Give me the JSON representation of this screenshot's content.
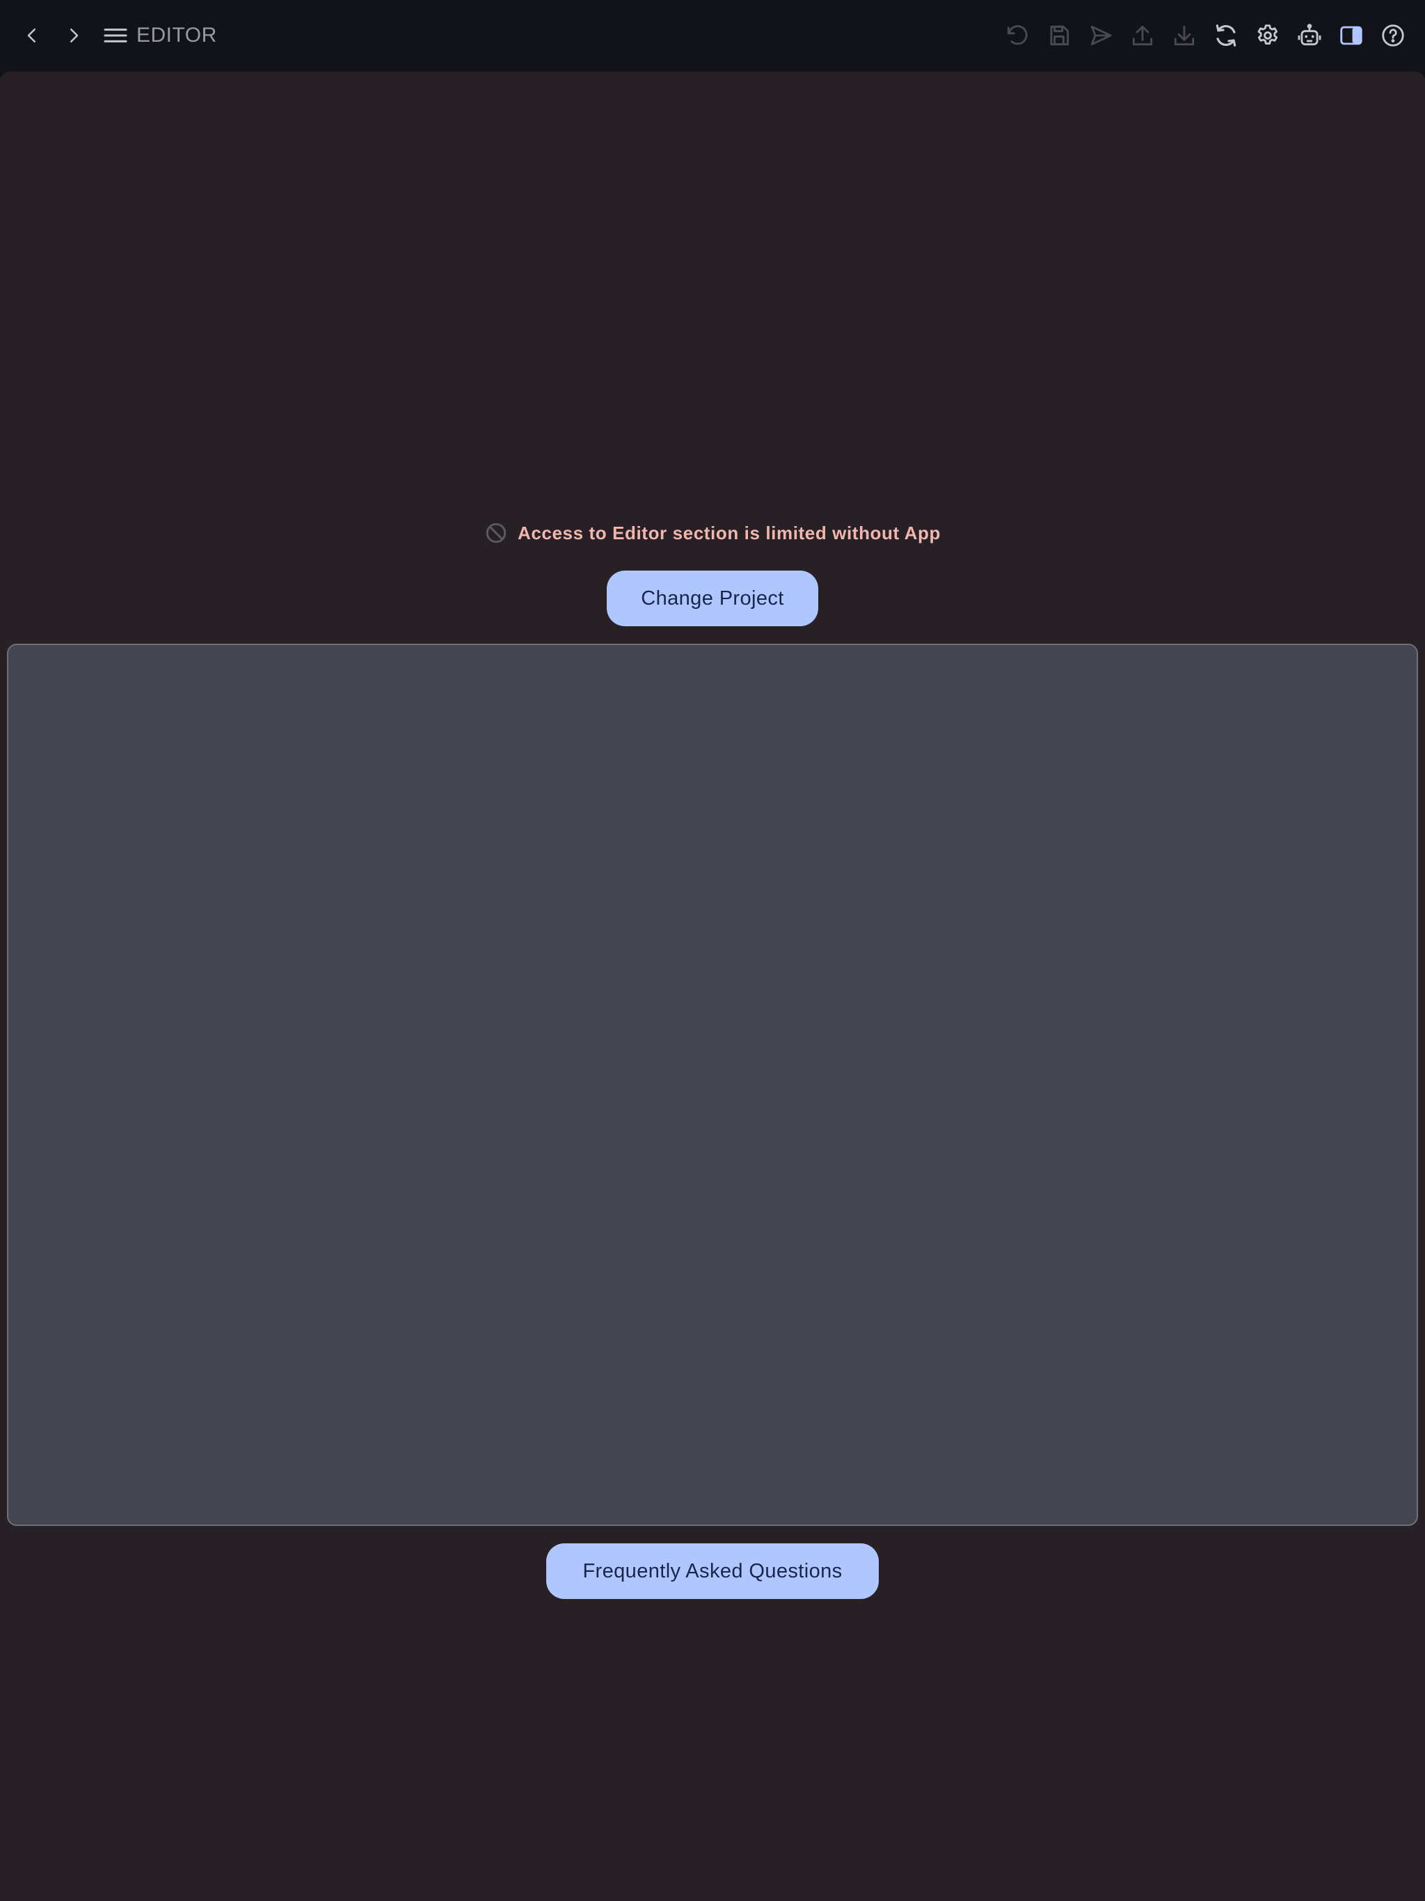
{
  "header": {
    "title": "EDITOR",
    "nav": {
      "back_icon": "chevron-left-icon",
      "forward_icon": "chevron-right-icon",
      "menu_icon": "menu-icon"
    },
    "toolbar": [
      {
        "icon": "undo-icon",
        "enabled": false
      },
      {
        "icon": "save-icon",
        "enabled": false
      },
      {
        "icon": "send-icon",
        "enabled": false
      },
      {
        "icon": "upload-icon",
        "enabled": false
      },
      {
        "icon": "download-icon",
        "enabled": false
      },
      {
        "icon": "sync-icon",
        "enabled": true
      },
      {
        "icon": "gear-icon",
        "enabled": true
      },
      {
        "icon": "robot-icon",
        "enabled": true
      },
      {
        "icon": "side-panel-icon",
        "enabled": true,
        "active": true
      },
      {
        "icon": "help-icon",
        "enabled": true
      }
    ]
  },
  "main": {
    "notice": {
      "icon": "blocked-icon",
      "text": "Access to Editor section is limited without App"
    },
    "change_project_label": "Change Project",
    "faq_label": "Frequently Asked Questions"
  },
  "colors": {
    "topbar_bg": "#121319",
    "panel_bg": "#272126",
    "preview_bg": "#44464f",
    "accent": "#b0c6ff",
    "accent_text": "#18264a",
    "notice_text": "#f2b6ae",
    "icon_disabled": "#4a4b52",
    "icon_enabled": "#c4c6d0"
  }
}
